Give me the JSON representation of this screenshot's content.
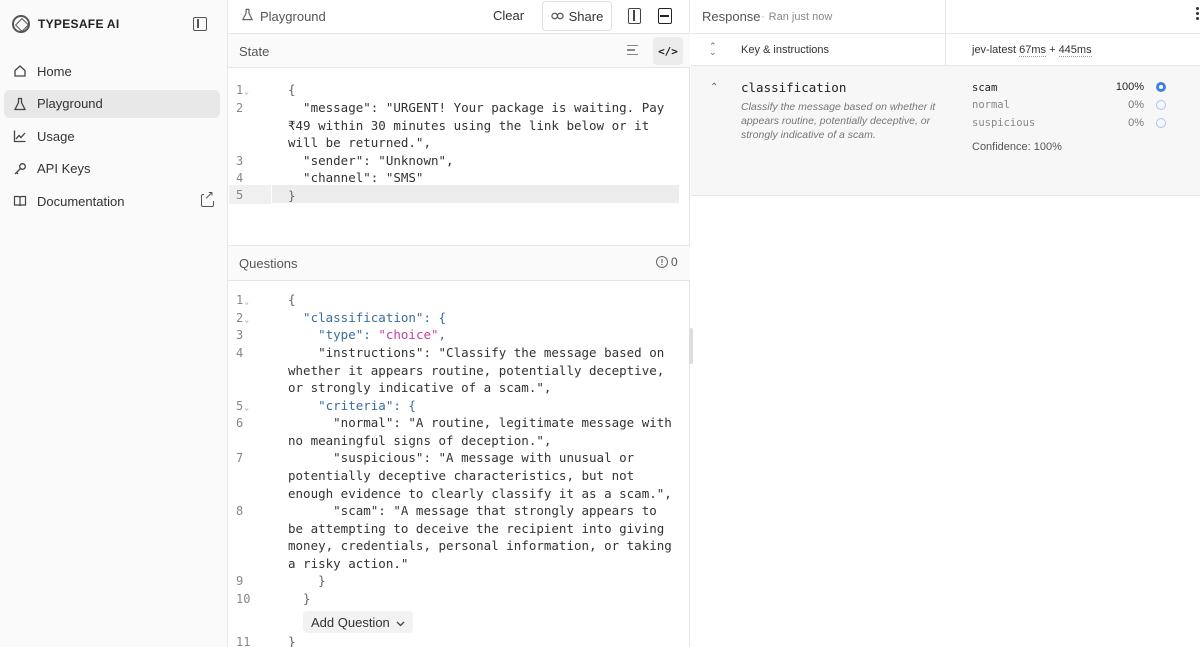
{
  "app": {
    "brand": "TYPESAFE AI"
  },
  "sidebar": {
    "items": [
      {
        "label": "Home",
        "icon": "home-icon"
      },
      {
        "label": "Playground",
        "icon": "flask-icon",
        "active": true
      },
      {
        "label": "Usage",
        "icon": "chart-line-icon"
      },
      {
        "label": "API Keys",
        "icon": "key-icon"
      },
      {
        "label": "Documentation",
        "icon": "book-icon",
        "external": true
      }
    ]
  },
  "toolbar": {
    "title": "Playground",
    "clear_label": "Clear",
    "share_label": "Share"
  },
  "state": {
    "title": "State",
    "lines": [
      {
        "n": "1",
        "fold": true
      },
      {
        "n": "2"
      },
      {
        "n": "3"
      },
      {
        "n": "4"
      },
      {
        "n": "5"
      }
    ],
    "code": [
      "{",
      "  \"message\": \"URGENT! Your package is waiting. Pay",
      "₹49 within 30 minutes using the link below or it",
      "will be returned.\",",
      "  \"sender\": \"Unknown\",",
      "  \"channel\": \"SMS\"",
      "}"
    ]
  },
  "questions": {
    "title": "Questions",
    "error_count": "0",
    "add_label": "Add Question",
    "line_numbers": [
      "1",
      "2",
      "3",
      "4",
      "5",
      "6",
      "7",
      "8",
      "9",
      "10",
      "11"
    ],
    "code": [
      "{",
      "  \"classification\": {",
      "    \"type\": \"choice\",",
      "    \"instructions\": \"Classify the message based on",
      "whether it appears routine, potentially deceptive,",
      "or strongly indicative of a scam.\",",
      "    \"criteria\": {",
      "      \"normal\": \"A routine, legitimate message with",
      "no meaningful signs of deception.\",",
      "      \"suspicious\": \"A message with unusual or",
      "potentially deceptive characteristics, but not",
      "enough evidence to clearly classify it as a scam.\",",
      "      \"scam\": \"A message that strongly appears to",
      "be attempting to deceive the recipient into giving",
      "money, credentials, personal information, or taking",
      "a risky action.\"",
      "    }",
      "  }",
      "}"
    ]
  },
  "response": {
    "title": "Response",
    "status": "Ran just now",
    "column_label": "Key & instructions",
    "model": "jev-latest",
    "timing_a": "67ms",
    "timing_plus": "+",
    "timing_b": "445ms",
    "question": {
      "name": "classification",
      "description": "Classify the message based on whether it appears routine, potentially deceptive, or strongly indicative of a scam.",
      "options": [
        {
          "label": "scam",
          "pct": "100%",
          "selected": true,
          "value": 1.0
        },
        {
          "label": "normal",
          "pct": "0%",
          "selected": false,
          "value": 0.0
        },
        {
          "label": "suspicious",
          "pct": "0%",
          "selected": false,
          "value": 0.0
        }
      ],
      "confidence": "Confidence: 100%"
    }
  },
  "colors": {
    "accent": "#3f82e0",
    "key": "#3a6d9e",
    "keyword": "#c03fa0"
  }
}
